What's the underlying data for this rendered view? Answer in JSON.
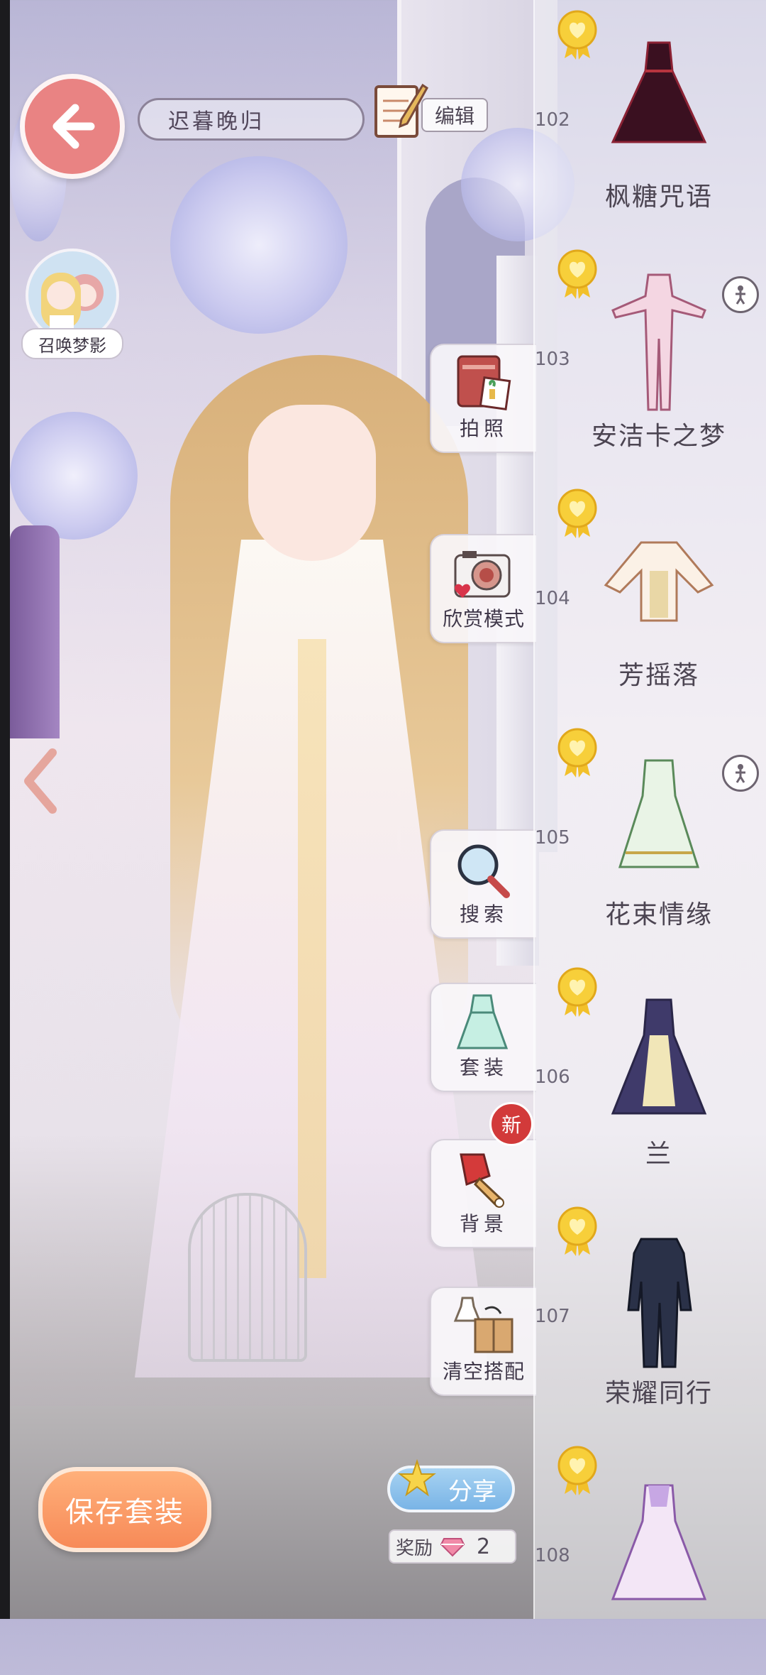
{
  "header": {
    "back_label": "",
    "outfit_name": "迟暮晚归",
    "edit_label": "编辑"
  },
  "summon": {
    "label": "召唤梦影"
  },
  "side_menu": [
    {
      "id": "photo",
      "label": "拍照",
      "icon": "photo-album-icon"
    },
    {
      "id": "appreciate",
      "label": "欣赏模式",
      "icon": "camera-icon"
    },
    {
      "id": "search",
      "label": "搜索",
      "icon": "magnifier-icon"
    },
    {
      "id": "suit",
      "label": "套装",
      "icon": "dress-icon"
    },
    {
      "id": "background",
      "label": "背景",
      "icon": "paint-brush-icon",
      "badge": "新"
    },
    {
      "id": "clear",
      "label": "清空搭配",
      "icon": "box-icon"
    }
  ],
  "outfits": [
    {
      "number": "102",
      "name": "枫糖咒语",
      "pose": false
    },
    {
      "number": "103",
      "name": "安洁卡之梦",
      "pose": true
    },
    {
      "number": "104",
      "name": "芳摇落",
      "pose": false
    },
    {
      "number": "105",
      "name": "花束情缘",
      "pose": true
    },
    {
      "number": "106",
      "name": "兰",
      "pose": false
    },
    {
      "number": "107",
      "name": "荣耀同行",
      "pose": false
    },
    {
      "number": "108",
      "name": "",
      "pose": false
    }
  ],
  "bottom": {
    "save_label": "保存套装",
    "share_label": "分享",
    "reward_label": "奖励",
    "reward_count": "2"
  },
  "colors": {
    "back_button": "#e98383",
    "save_button": "#f78a58",
    "share_button": "#79b4e6",
    "medal": "#f2c02a",
    "new_badge": "#d23a3a"
  }
}
